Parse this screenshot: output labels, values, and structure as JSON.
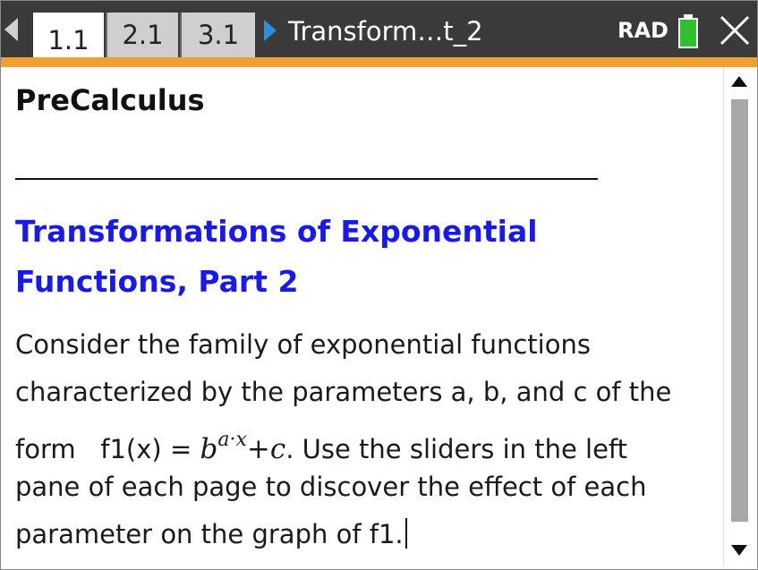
{
  "tabs": [
    {
      "label": "1.1",
      "active": true
    },
    {
      "label": "2.1",
      "active": false
    },
    {
      "label": "3.1",
      "active": false
    }
  ],
  "document": {
    "title": "Transform…t_2"
  },
  "status": {
    "angle_mode": "RAD",
    "battery_color": "#2fbf2f"
  },
  "icons": {
    "left": "left-arrow-icon",
    "doc": "document-arrow-icon",
    "close": "close-icon"
  },
  "colors": {
    "topbar": "#3a3a3a",
    "accent": "#f0a030",
    "title": "#1a1ae6"
  },
  "content": {
    "heading": "PreCalculus",
    "title_lines": [
      "Transformations of Exponential",
      "Functions, Part 2"
    ],
    "paragraph": {
      "line1": "Consider the family of exponential functions",
      "line2": "characterized by the parameters a, b, and c of the",
      "line3_start": "form   f1(x) = ",
      "formula_base": "b",
      "formula_exponent": "a·x",
      "formula_tail": "+c",
      "line3_end": ". Use the sliders in the left",
      "line4": "pane of each page to discover the effect of each",
      "line5": "parameter on the graph of f1."
    }
  }
}
